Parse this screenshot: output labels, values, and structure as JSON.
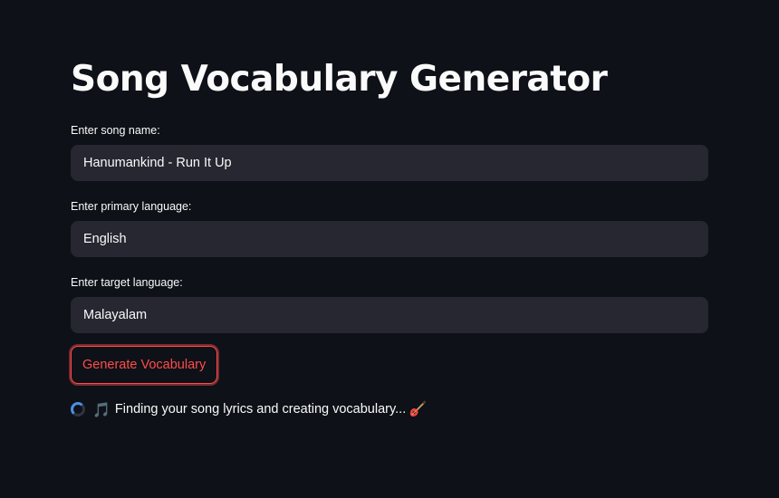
{
  "page": {
    "title": "Song Vocabulary Generator"
  },
  "form": {
    "song": {
      "label": "Enter song name:",
      "value": "Hanumankind - Run It Up"
    },
    "primary_language": {
      "label": "Enter primary language:",
      "value": "English"
    },
    "target_language": {
      "label": "Enter target language:",
      "value": "Malayalam"
    },
    "generate_label": "Generate Vocabulary"
  },
  "status": {
    "music_emoji": "🎵",
    "message": "Finding your song lyrics and creating vocabulary...",
    "icons": [
      "spinner-icon",
      "music-note-icon",
      "guitar-icon"
    ]
  },
  "colors": {
    "background": "#0e1117",
    "input_background": "#262730",
    "accent": "#ff4b4b",
    "spinner": "#4a90e2"
  }
}
